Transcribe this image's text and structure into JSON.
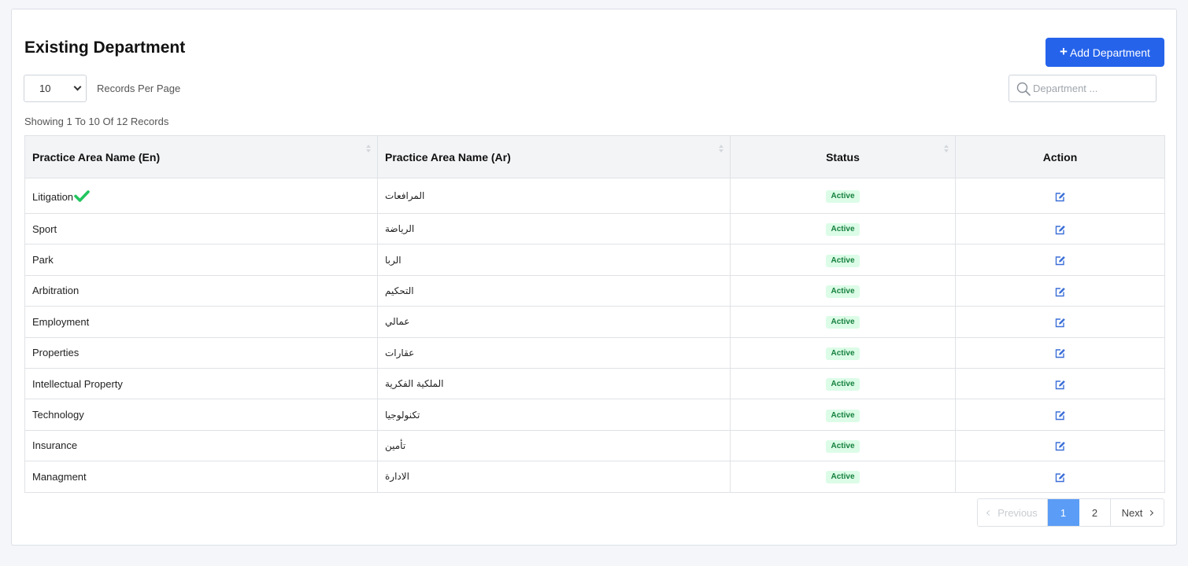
{
  "page": {
    "title": "Existing Department",
    "add_button_label": "Add Department"
  },
  "controls": {
    "records_per_page_value": "10",
    "records_per_page_label": "Records Per Page",
    "search_placeholder": "Department ...",
    "showing_text": "Showing 1 To 10 Of 12 Records"
  },
  "table": {
    "columns": [
      "Practice Area Name (En)",
      "Practice Area Name (Ar)",
      "Status",
      "Action"
    ],
    "rows": [
      {
        "en": "Litigation",
        "ar": "المرافعات",
        "status": "Active",
        "checked": true
      },
      {
        "en": "Sport",
        "ar": "الرياضة",
        "status": "Active"
      },
      {
        "en": "Park",
        "ar": "الربا",
        "status": "Active"
      },
      {
        "en": "Arbitration",
        "ar": "التحكيم",
        "status": "Active"
      },
      {
        "en": "Employment",
        "ar": "عمالي",
        "status": "Active"
      },
      {
        "en": "Properties",
        "ar": "عقارات",
        "status": "Active"
      },
      {
        "en": "Intellectual Property",
        "ar": "الملكية الفكرية",
        "status": "Active"
      },
      {
        "en": "Technology",
        "ar": "تكنولوجيا",
        "status": "Active"
      },
      {
        "en": "Insurance",
        "ar": "تأمين",
        "status": "Active"
      },
      {
        "en": "Managment",
        "ar": "الادارة",
        "status": "Active"
      }
    ]
  },
  "pagination": {
    "previous_label": "Previous",
    "pages": [
      "1",
      "2"
    ],
    "current_page": "1",
    "next_label": "Next"
  },
  "colors": {
    "primary": "#2563eb",
    "active_page": "#5b9df6",
    "status_bg": "#dcfce7",
    "status_text": "#15803d",
    "check": "#22c55e",
    "edit_icon": "#3b6fd8"
  },
  "icons": {
    "add_button": "plus-icon",
    "search": "search-icon",
    "litigation_mark": "check-icon",
    "row_action": "edit-icon"
  }
}
